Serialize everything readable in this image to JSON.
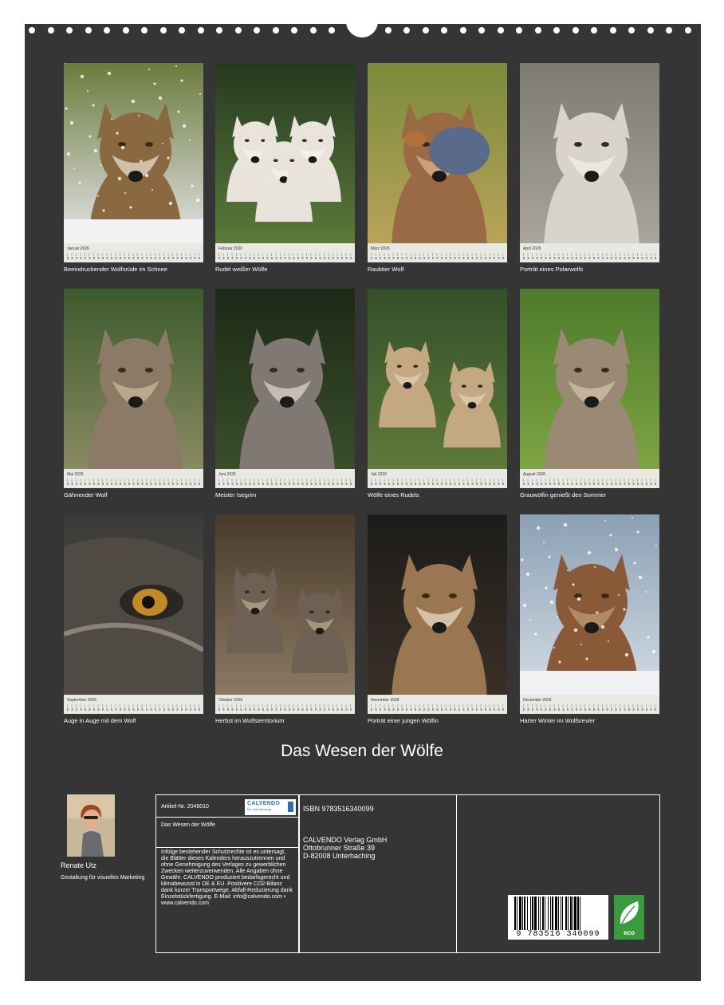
{
  "calendar": {
    "title": "Das Wesen der Wölfe",
    "months": [
      {
        "month": "Januar 2026",
        "caption": "Beeindruckender Wolfsrüde im Schnee"
      },
      {
        "month": "Februar 2026",
        "caption": "Rudel weißer Wölfe"
      },
      {
        "month": "März 2026",
        "caption": "Raubtier Wolf"
      },
      {
        "month": "April 2026",
        "caption": "Porträt eines Polarwolfs"
      },
      {
        "month": "Mai 2026",
        "caption": "Gähnender Wolf"
      },
      {
        "month": "Juni 2026",
        "caption": "Meister Isegrim"
      },
      {
        "month": "Juli 2026",
        "caption": "Wölfe eines Rudels"
      },
      {
        "month": "August 2026",
        "caption": "Grauwölfin genießt den Sommer"
      },
      {
        "month": "September 2026",
        "caption": "Auge in Auge mit dem Wolf"
      },
      {
        "month": "Oktober 2026",
        "caption": "Herbst im Wolfsterritorium"
      },
      {
        "month": "November 2026",
        "caption": "Porträt einer jungen Wölfin"
      },
      {
        "month": "Dezember 2026",
        "caption": "Harter Winter im Wolfsrevier"
      }
    ]
  },
  "author": {
    "name": "Renate Utz",
    "role": "Gestaltung für visuelles Marketing"
  },
  "info": {
    "article_no": "Artikel-Nr. 2049010",
    "product_title": "Das Wesen der Wölfe",
    "legal_text": "Infolge bestehender Schutzrechte ist es untersagt, die Blätter dieses Kalenders herauszutrennen und ohne Genehmigung des Verlages zu gewerblichen Zwecken weiterzuverwenden. Alle Angaben ohne Gewähr. CALVENDO produziert bedarfsgerecht und klimabewusst in DE & EU. Positivere CO2-Bilanz dank kurzer Transportwege. Abfall-Reduzierung dank Einzelstückfertigung. E-Mail: info@calvendo.com • www.calvendo.com",
    "isbn": "ISBN 9783516340099",
    "publisher": "CALVENDO Verlag GmbH",
    "street": "Ottobrunner Straße 39",
    "city": "D-82008 Unterhaching",
    "logo_text": "CALVENDO",
    "logo_sub": "Der Kalenderverlag",
    "barcode_digits": "9 783516 340099",
    "eco_label": "eco"
  }
}
